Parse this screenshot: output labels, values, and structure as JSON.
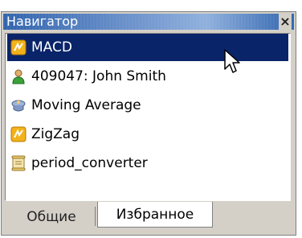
{
  "panel": {
    "title": "Навигатор",
    "close_glyph": "×"
  },
  "items": [
    {
      "label": "MACD",
      "icon": "indicator-icon",
      "selected": true
    },
    {
      "label": "409047: John Smith",
      "icon": "account-icon",
      "selected": false
    },
    {
      "label": "Moving Average",
      "icon": "expert-advisor-icon",
      "selected": false
    },
    {
      "label": "ZigZag",
      "icon": "indicator-icon",
      "selected": false
    },
    {
      "label": "period_converter",
      "icon": "script-icon",
      "selected": false
    }
  ],
  "tabs": [
    {
      "label": "Общие",
      "active": false
    },
    {
      "label": "Избранное",
      "active": true
    }
  ],
  "colors": {
    "selection": "#0a246a",
    "titlebar": "#3e6fb3",
    "panel_bg": "#d4d0c8"
  }
}
